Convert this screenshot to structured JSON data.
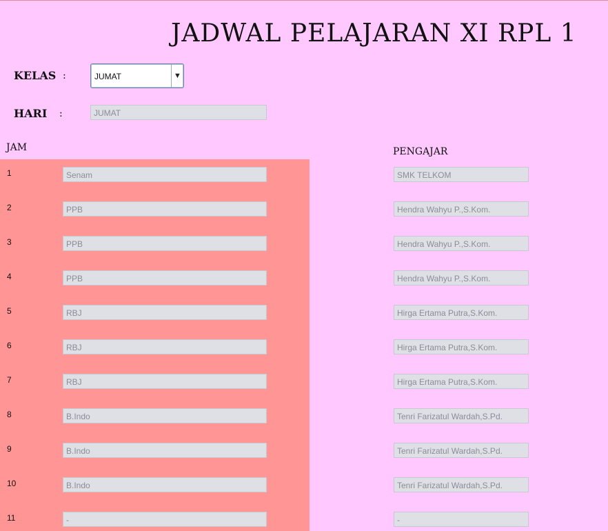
{
  "title": "JADWAL PELAJARAN XI RPL 1",
  "kelas": {
    "label": "KELAS",
    "colon": ":",
    "selected": "JUMAT",
    "arrow": "▼"
  },
  "hari": {
    "label": "HARI",
    "colon": ":",
    "value": "JUMAT"
  },
  "headers": {
    "jam": "JAM",
    "pengajar": "PENGAJAR"
  },
  "rows": [
    {
      "jam": "1",
      "subject": "Senam",
      "teacher": "SMK TELKOM"
    },
    {
      "jam": "2",
      "subject": "PPB",
      "teacher": "Hendra Wahyu P.,S.Kom."
    },
    {
      "jam": "3",
      "subject": "PPB",
      "teacher": "Hendra Wahyu P.,S.Kom."
    },
    {
      "jam": "4",
      "subject": "PPB",
      "teacher": "Hendra Wahyu P.,S.Kom."
    },
    {
      "jam": "5",
      "subject": "RBJ",
      "teacher": "Hirga Ertama Putra,S.Kom."
    },
    {
      "jam": "6",
      "subject": "RBJ",
      "teacher": "Hirga Ertama Putra,S.Kom."
    },
    {
      "jam": "7",
      "subject": "RBJ",
      "teacher": "Hirga Ertama Putra,S.Kom."
    },
    {
      "jam": "8",
      "subject": "B.Indo",
      "teacher": "Tenri Farizatul Wardah,S.Pd."
    },
    {
      "jam": "9",
      "subject": "B.Indo",
      "teacher": "Tenri Farizatul Wardah,S.Pd."
    },
    {
      "jam": "10",
      "subject": "B.Indo",
      "teacher": "Tenri Farizatul Wardah,S.Pd."
    },
    {
      "jam": "11",
      "subject": "-",
      "teacher": "-"
    }
  ]
}
